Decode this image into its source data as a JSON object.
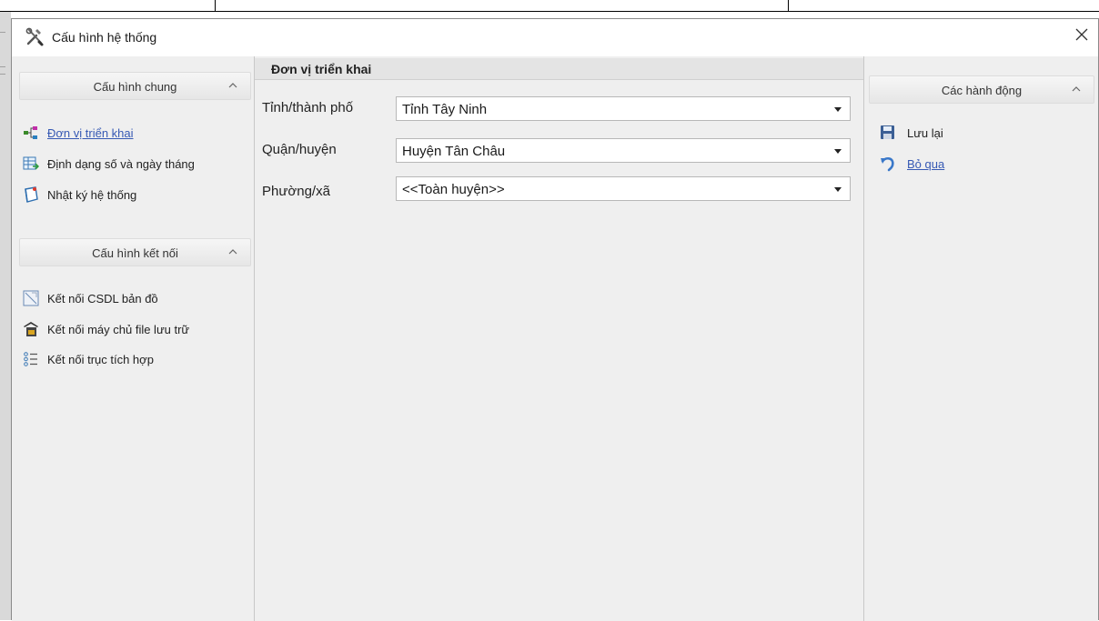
{
  "dialog": {
    "title": "Cấu hình hệ thống"
  },
  "left_panel": {
    "group_general": {
      "header": "Cấu hình chung",
      "items": [
        {
          "label": "Đơn vị triển khai",
          "icon": "tree-hierarchy-icon"
        },
        {
          "label": "Định dạng số và ngày tháng",
          "icon": "table-format-icon"
        },
        {
          "label": "Nhật ký hệ thống",
          "icon": "log-notebook-icon"
        }
      ]
    },
    "group_connection": {
      "header": "Cấu hình kết nối",
      "items": [
        {
          "label": "Kết nối CSDL bản đồ",
          "icon": "map-database-icon"
        },
        {
          "label": "Kết nối máy chủ file lưu trữ",
          "icon": "file-server-icon"
        },
        {
          "label": "Kết nối trục tích hợp",
          "icon": "integration-list-icon"
        }
      ]
    }
  },
  "main": {
    "section_title": "Đơn vị triển khai",
    "fields": [
      {
        "label": "Tỉnh/thành phố",
        "value": "Tỉnh Tây Ninh"
      },
      {
        "label": "Quận/huyện",
        "value": "Huyện Tân Châu"
      },
      {
        "label": "Phường/xã",
        "value": "<<Toàn huyện>>"
      }
    ]
  },
  "right_panel": {
    "header": "Các hành động",
    "actions": [
      {
        "label": "Lưu lại",
        "icon": "save-floppy-icon"
      },
      {
        "label": "Bỏ qua",
        "icon": "undo-arrow-icon"
      }
    ]
  },
  "colors": {
    "link": "#3659b4",
    "panel_bg": "#efefef",
    "section_header_bg": "#e4e4e4"
  }
}
